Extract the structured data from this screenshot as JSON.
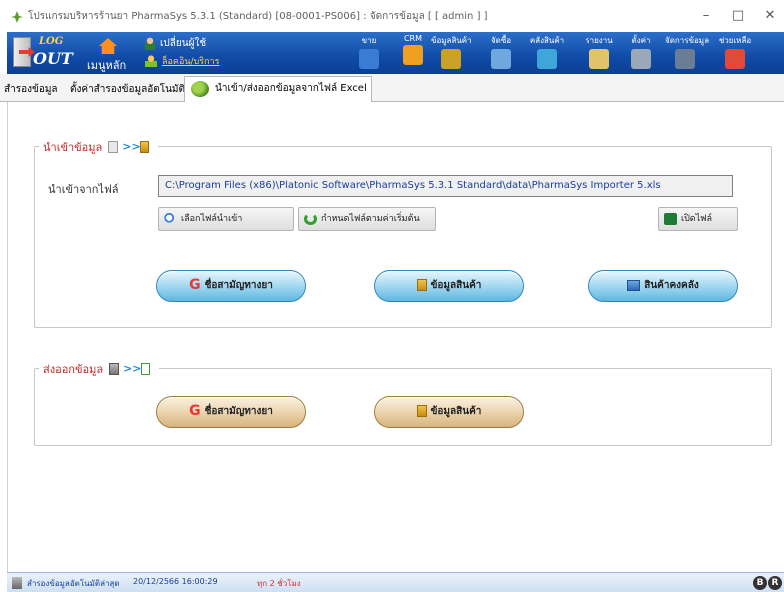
{
  "window": {
    "title": "โปรแกรมบริหารร้านยา PharmaSys 5.3.1 (Standard) [08-0001-PS006] : จัดการข้อมูล [ [ admin ] ]",
    "min": "–",
    "max": "□",
    "close": "✕"
  },
  "toolbar": {
    "logout_top": "LOG",
    "logout_bottom": "OUT",
    "home_label": "เมนูหลัก",
    "change_user": "เปลี่ยนผู้ใช้",
    "online_services": "ล็อคอิน/บริการ",
    "items": [
      {
        "label": "ขาย",
        "color": "#3a7bd5"
      },
      {
        "label": "CRM",
        "color": "#f0a020"
      },
      {
        "label": "ข้อมูลสินค้า",
        "color": "#c9a227"
      },
      {
        "label": "จัดซื้อ",
        "color": "#6fa8dc"
      },
      {
        "label": "คลังสินค้า",
        "color": "#3ea6d8"
      },
      {
        "label": "รายงาน",
        "color": "#e0c36a"
      },
      {
        "label": "ตั้งค่า",
        "color": "#9aa8b8"
      },
      {
        "label": "จัดการข้อมูล",
        "color": "#6b7d96"
      },
      {
        "label": "ช่วยเหลือ",
        "color": "#e04a3a"
      }
    ]
  },
  "tabs": [
    {
      "label": "สำรองข้อมูล"
    },
    {
      "label": "ตั้งค่าสำรองข้อมูลอัตโนมัติ"
    },
    {
      "label": "นำเข้า/ส่งออกข้อมูลจากไฟล์ Excel",
      "active": true
    }
  ],
  "import_section": {
    "title": "นำเข้าข้อมูล",
    "file_label": "นำเข้าจากไฟล์",
    "file_path": "C:\\Program Files (x86)\\Platonic Software\\PharmaSys 5.3.1 Standard\\data\\PharmaSys Importer 5.xls",
    "select_file": "เลือกไฟล์นำเข้า",
    "reset_default": "กำหนดไฟล์ตามค่าเริ่มต้น",
    "open_file": "เปิดไฟล์",
    "btn_generic": "ชื่อสามัญทางยา",
    "btn_product": "ข้อมูลสินค้า",
    "btn_stock": "สินค้าคงคลัง"
  },
  "export_section": {
    "title": "ส่งออกข้อมูล",
    "btn_generic": "ชื่อสามัญทางยา",
    "btn_product": "ข้อมูลสินค้า"
  },
  "statusbar": {
    "label": "สำรองข้อมูลอัตโนมัติล่าสุด",
    "datetime": "20/12/2566 16:00:29",
    "every": "ทุก 2 ชั่วโมง",
    "badge1": "B",
    "badge2": "R"
  }
}
